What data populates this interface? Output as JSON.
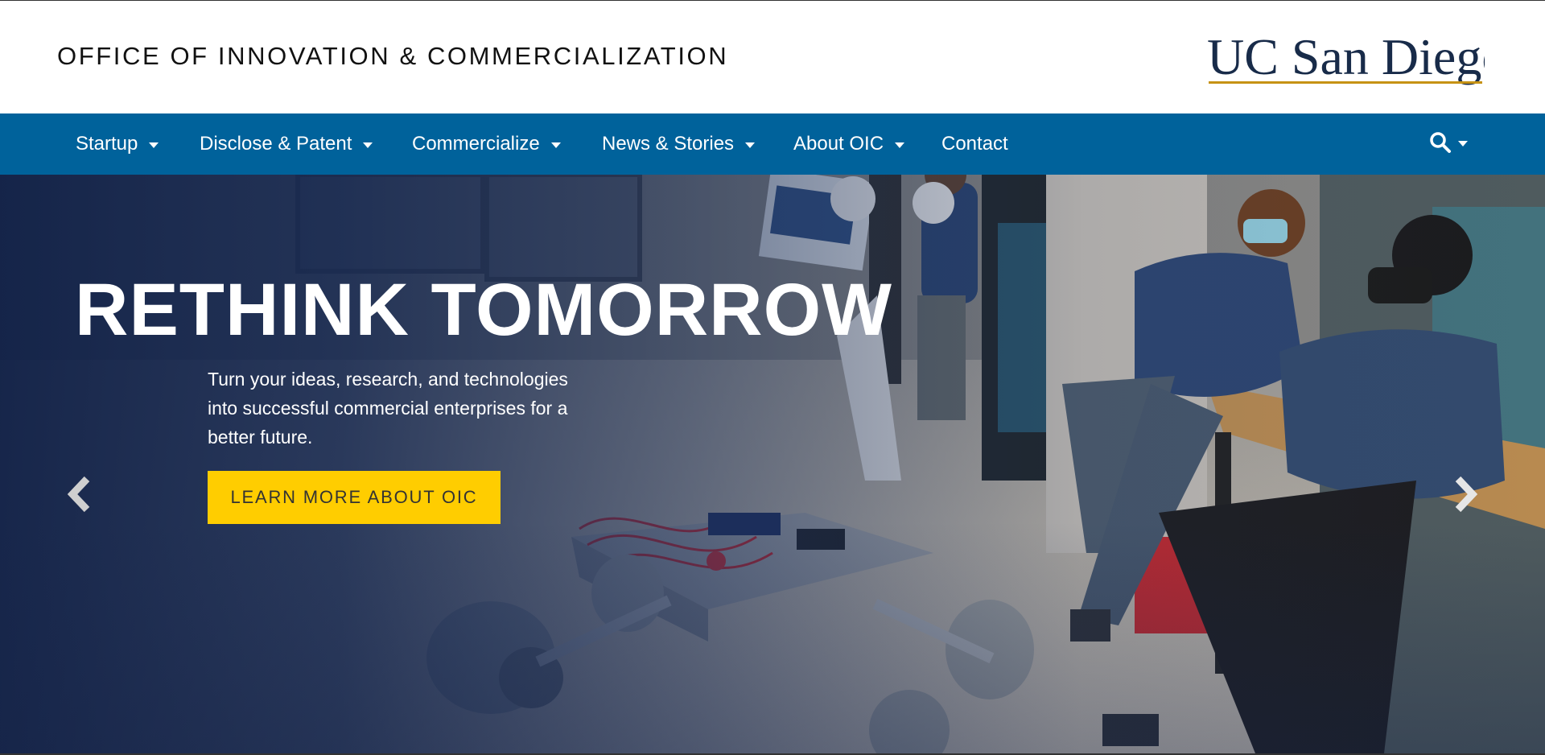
{
  "header": {
    "site_title": "OFFICE OF INNOVATION & COMMERCIALIZATION",
    "logo_text": "UC San Diego"
  },
  "nav": {
    "items": [
      {
        "label": "Startup",
        "has_dropdown": true
      },
      {
        "label": "Disclose & Patent",
        "has_dropdown": true
      },
      {
        "label": "Commercialize",
        "has_dropdown": true
      },
      {
        "label": "News & Stories",
        "has_dropdown": true
      },
      {
        "label": "About OIC",
        "has_dropdown": true
      },
      {
        "label": "Contact",
        "has_dropdown": false
      }
    ],
    "search_icon": "search-icon"
  },
  "hero": {
    "title": "RETHINK TOMORROW",
    "text": "Turn your ideas, research, and technologies into successful commercial enterprises for a better future.",
    "cta_label": "LEARN MORE ABOUT OIC",
    "prev_icon": "chevron-left-icon",
    "next_icon": "chevron-right-icon"
  },
  "colors": {
    "nav_blue": "#00629b",
    "gold": "#ffcd00",
    "navy": "#182b49"
  }
}
